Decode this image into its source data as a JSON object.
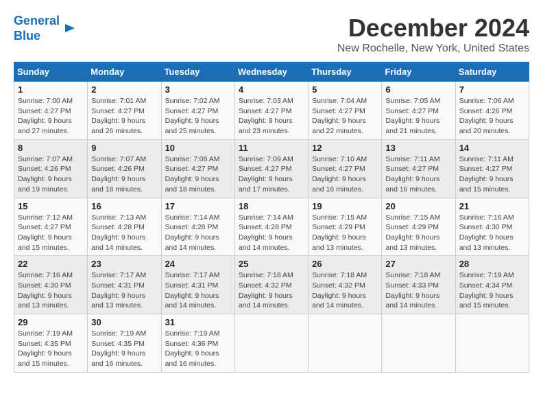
{
  "logo": {
    "line1": "General",
    "line2": "Blue"
  },
  "title": "December 2024",
  "subtitle": "New Rochelle, New York, United States",
  "days_of_week": [
    "Sunday",
    "Monday",
    "Tuesday",
    "Wednesday",
    "Thursday",
    "Friday",
    "Saturday"
  ],
  "weeks": [
    [
      {
        "day": "1",
        "info": "Sunrise: 7:00 AM\nSunset: 4:27 PM\nDaylight: 9 hours\nand 27 minutes."
      },
      {
        "day": "2",
        "info": "Sunrise: 7:01 AM\nSunset: 4:27 PM\nDaylight: 9 hours\nand 26 minutes."
      },
      {
        "day": "3",
        "info": "Sunrise: 7:02 AM\nSunset: 4:27 PM\nDaylight: 9 hours\nand 25 minutes."
      },
      {
        "day": "4",
        "info": "Sunrise: 7:03 AM\nSunset: 4:27 PM\nDaylight: 9 hours\nand 23 minutes."
      },
      {
        "day": "5",
        "info": "Sunrise: 7:04 AM\nSunset: 4:27 PM\nDaylight: 9 hours\nand 22 minutes."
      },
      {
        "day": "6",
        "info": "Sunrise: 7:05 AM\nSunset: 4:27 PM\nDaylight: 9 hours\nand 21 minutes."
      },
      {
        "day": "7",
        "info": "Sunrise: 7:06 AM\nSunset: 4:26 PM\nDaylight: 9 hours\nand 20 minutes."
      }
    ],
    [
      {
        "day": "8",
        "info": "Sunrise: 7:07 AM\nSunset: 4:26 PM\nDaylight: 9 hours\nand 19 minutes."
      },
      {
        "day": "9",
        "info": "Sunrise: 7:07 AM\nSunset: 4:26 PM\nDaylight: 9 hours\nand 18 minutes."
      },
      {
        "day": "10",
        "info": "Sunrise: 7:08 AM\nSunset: 4:27 PM\nDaylight: 9 hours\nand 18 minutes."
      },
      {
        "day": "11",
        "info": "Sunrise: 7:09 AM\nSunset: 4:27 PM\nDaylight: 9 hours\nand 17 minutes."
      },
      {
        "day": "12",
        "info": "Sunrise: 7:10 AM\nSunset: 4:27 PM\nDaylight: 9 hours\nand 16 minutes."
      },
      {
        "day": "13",
        "info": "Sunrise: 7:11 AM\nSunset: 4:27 PM\nDaylight: 9 hours\nand 16 minutes."
      },
      {
        "day": "14",
        "info": "Sunrise: 7:11 AM\nSunset: 4:27 PM\nDaylight: 9 hours\nand 15 minutes."
      }
    ],
    [
      {
        "day": "15",
        "info": "Sunrise: 7:12 AM\nSunset: 4:27 PM\nDaylight: 9 hours\nand 15 minutes."
      },
      {
        "day": "16",
        "info": "Sunrise: 7:13 AM\nSunset: 4:28 PM\nDaylight: 9 hours\nand 14 minutes."
      },
      {
        "day": "17",
        "info": "Sunrise: 7:14 AM\nSunset: 4:28 PM\nDaylight: 9 hours\nand 14 minutes."
      },
      {
        "day": "18",
        "info": "Sunrise: 7:14 AM\nSunset: 4:28 PM\nDaylight: 9 hours\nand 14 minutes."
      },
      {
        "day": "19",
        "info": "Sunrise: 7:15 AM\nSunset: 4:29 PM\nDaylight: 9 hours\nand 13 minutes."
      },
      {
        "day": "20",
        "info": "Sunrise: 7:15 AM\nSunset: 4:29 PM\nDaylight: 9 hours\nand 13 minutes."
      },
      {
        "day": "21",
        "info": "Sunrise: 7:16 AM\nSunset: 4:30 PM\nDaylight: 9 hours\nand 13 minutes."
      }
    ],
    [
      {
        "day": "22",
        "info": "Sunrise: 7:16 AM\nSunset: 4:30 PM\nDaylight: 9 hours\nand 13 minutes."
      },
      {
        "day": "23",
        "info": "Sunrise: 7:17 AM\nSunset: 4:31 PM\nDaylight: 9 hours\nand 13 minutes."
      },
      {
        "day": "24",
        "info": "Sunrise: 7:17 AM\nSunset: 4:31 PM\nDaylight: 9 hours\nand 14 minutes."
      },
      {
        "day": "25",
        "info": "Sunrise: 7:18 AM\nSunset: 4:32 PM\nDaylight: 9 hours\nand 14 minutes."
      },
      {
        "day": "26",
        "info": "Sunrise: 7:18 AM\nSunset: 4:32 PM\nDaylight: 9 hours\nand 14 minutes."
      },
      {
        "day": "27",
        "info": "Sunrise: 7:18 AM\nSunset: 4:33 PM\nDaylight: 9 hours\nand 14 minutes."
      },
      {
        "day": "28",
        "info": "Sunrise: 7:19 AM\nSunset: 4:34 PM\nDaylight: 9 hours\nand 15 minutes."
      }
    ],
    [
      {
        "day": "29",
        "info": "Sunrise: 7:19 AM\nSunset: 4:35 PM\nDaylight: 9 hours\nand 15 minutes."
      },
      {
        "day": "30",
        "info": "Sunrise: 7:19 AM\nSunset: 4:35 PM\nDaylight: 9 hours\nand 16 minutes."
      },
      {
        "day": "31",
        "info": "Sunrise: 7:19 AM\nSunset: 4:36 PM\nDaylight: 9 hours\nand 16 minutes."
      },
      null,
      null,
      null,
      null
    ]
  ]
}
